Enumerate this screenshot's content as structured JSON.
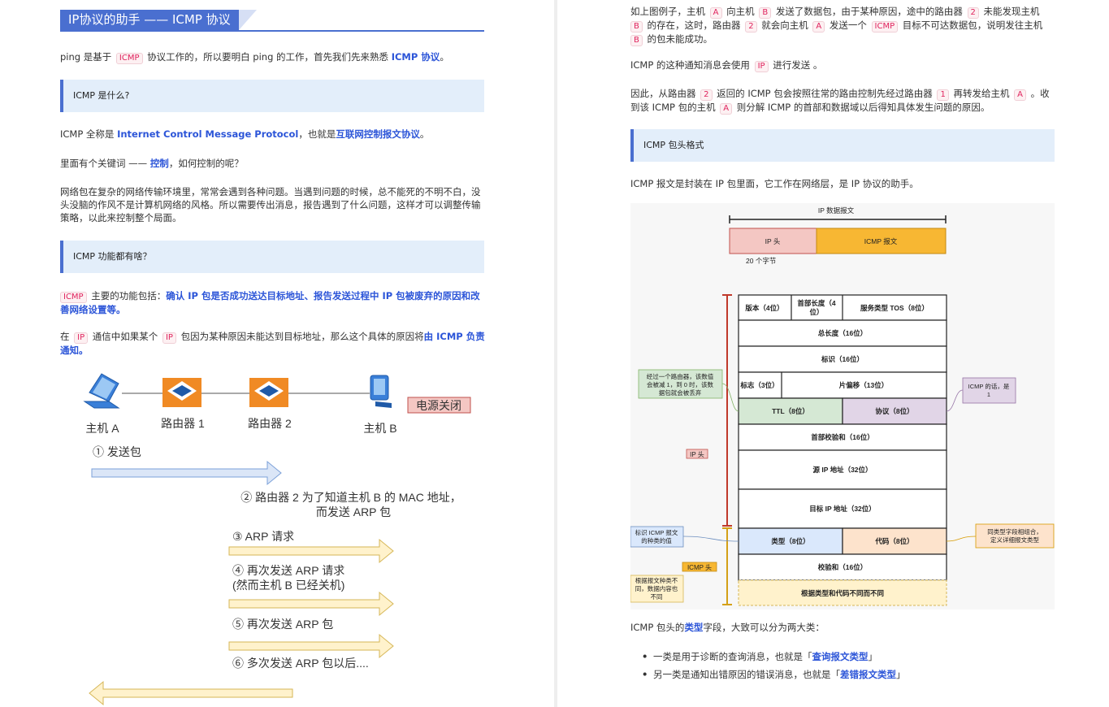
{
  "left": {
    "heading": "IP协议的助手 —— ICMP 协议",
    "p1": {
      "pre": "ping 是基于 ",
      "code": "ICMP",
      "mid": " 协议工作的，所以要明白 ping 的工作，首先我们先来熟悉 ",
      "link": "ICMP 协议",
      "post": "。"
    },
    "callout1": "ICMP 是什么?",
    "p2": {
      "pre": "ICMP 全称是 ",
      "link1": "Internet Control Message Protocol",
      "mid": "，也就是",
      "link2": "互联网控制报文协议",
      "post": "。"
    },
    "p3": {
      "pre": "里面有个关键词 —— ",
      "link": "控制",
      "post": "，如何控制的呢？"
    },
    "p4_line1": "网络包在复杂的网络传输环境里，常常会遇到各种问题。当遇到问题的时候，总不能死的不明不白，没",
    "p4_line2": "头没脑的作风不是计算机网络的风格。所以需要传出消息，报告遇到了什么问题，这样才可以调整传输",
    "p4_line3": "策略，以此来控制整个局面。",
    "callout2": "ICMP 功能都有啥？",
    "p5": {
      "code": "ICMP",
      "pre": " 主要的功能包括：",
      "link_line1": "确认 IP 包是否成功送达目标地址、报告发送过程中 IP 包被废弃的原因和改",
      "link_line2": "善网络设置等。"
    },
    "p6": {
      "pre": "在 ",
      "code1": "IP",
      "mid": " 通信中如果某个 ",
      "code2": "IP",
      "post": " 包因为某种原因未能达到目标地址，那么这个具体的原因将",
      "link_line1": "由 ICMP 负责",
      "link_line2": "通知。"
    },
    "diagram": {
      "host_a": "主机 A",
      "router1": "路由器 1",
      "router2": "路由器 2",
      "host_b": "主机 B",
      "power_off": "电源关闭",
      "step1": "① 发送包",
      "step2_line1": "② 路由器 2 为了知道主机 B 的 MAC 地址，",
      "step2_line2": "而发送 ARP 包",
      "step3": "③ ARP 请求",
      "step4_line1": "④ 再次发送 ARP 请求",
      "step4_line2": "(然而主机 B 已经关机)",
      "step5": "⑤ 再次发送 ARP 包",
      "step6": "⑥ 多次发送 ARP 包以后...."
    }
  },
  "right": {
    "p1": {
      "t1": "如上图例子，主机 ",
      "c1": "A",
      "t2": " 向主机 ",
      "c2": "B",
      "t3": " 发送了数据包，由于某种原因，途中的路由器 ",
      "c3": "2",
      "t4": " 未能发现主机",
      "c4": "B",
      "t5": " 的存在，这时，路由器 ",
      "c5": "2",
      "t6": " 就会向主机 ",
      "c6": "A",
      "t7": " 发送一个 ",
      "c7": "ICMP",
      "t8": " 目标不可达数据包，说明发往主机",
      "c8": "B",
      "t9": " 的包未能成功。"
    },
    "p2": {
      "pre": "ICMP 的这种通知消息会使用 ",
      "code": "IP",
      "post": " 进行发送 。"
    },
    "p3": {
      "t1": "因此，从路由器 ",
      "c1": "2",
      "t2": " 返回的 ICMP 包会按照往常的路由控制先经过路由器 ",
      "c2": "1",
      "t3": " 再转发给主机 ",
      "c3": "A",
      "t4": " 。收",
      "t5": "到该 ICMP 包的主机 ",
      "c4": "A",
      "t6": " 则分解 ICMP 的首部和数据域以后得知具体发生问题的原因。"
    },
    "callout": "ICMP 包头格式",
    "p4": "ICMP 报文是封装在 IP 包里面，它工作在网络层，是 IP 协议的助手。",
    "diagram": {
      "ip_datagram": "IP 数据报文",
      "ip_head": "IP 头",
      "icmp_msg": "ICMP 报文",
      "bytes20": "20 个字节",
      "version": "版本（4位）",
      "hdr_len_1": "首部长度（4",
      "hdr_len_2": "位）",
      "tos": "服务类型 TOS（8位）",
      "total_len": "总长度（16位）",
      "ident": "标识（16位）",
      "flags": "标志（3位）",
      "frag": "片偏移（13位）",
      "ttl": "TTL（8位）",
      "proto": "协议（8位）",
      "hdr_cksum": "首部校验和（16位）",
      "src": "源 IP 地址（32位）",
      "dst": "目标 IP 地址（32位）",
      "type": "类型（8位）",
      "code": "代码（8位）",
      "cksum": "校验和（16位）",
      "data": "根据类型和代码不同而不同",
      "ip_head_tag": "IP 头",
      "icmp_head_tag": "ICMP 头",
      "note_ttl_1": "经过一个路由器，该数值",
      "note_ttl_2": "会被减 1，到 0 时，该数",
      "note_ttl_3": "据包就会被丢弃",
      "note_proto_1": "ICMP 的话，是",
      "note_proto_2": "1",
      "note_type_1": "标识 ICMP 报文",
      "note_type_2": "的种类的值",
      "note_code_1": "同类型字段相组合，",
      "note_code_2": "定义详细报文类型",
      "note_data_1": "根据报文种类不",
      "note_data_2": "同，数据内容也",
      "note_data_3": "不同"
    },
    "p5": {
      "pre": "ICMP 包头的",
      "link": "类型",
      "post": "字段，大致可以分为两大类："
    },
    "bullets": [
      {
        "pre": "一类是用于诊断的查询消息，也就是「",
        "link": "查询报文类型",
        "post": "」"
      },
      {
        "pre": "另一类是通知出错原因的错误消息，也就是「",
        "link": "差错报文类型",
        "post": "」"
      }
    ],
    "colors": {
      "accent": "#4a6fd0",
      "link": "#2c55d8",
      "ip_head_fill": "#f4c7c3",
      "icmp_fill": "#f7b733"
    }
  }
}
